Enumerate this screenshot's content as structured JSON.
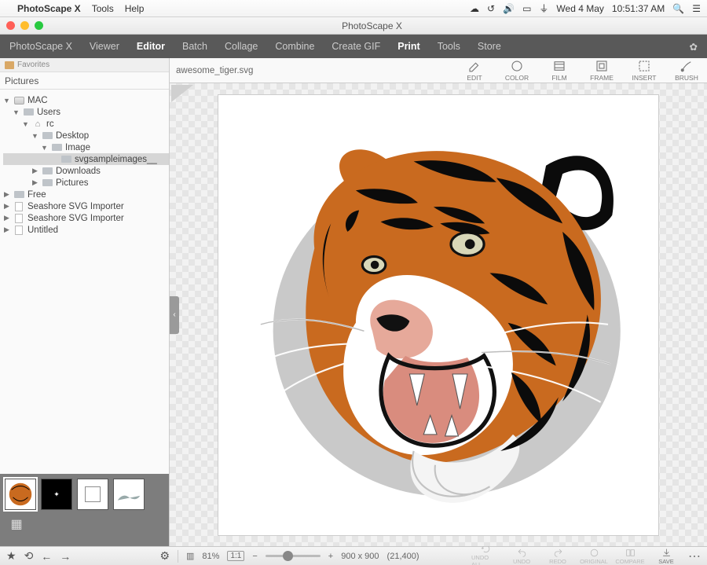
{
  "menubar": {
    "app_name": "PhotoScape X",
    "items": [
      "Tools",
      "Help"
    ],
    "date": "Wed 4 May",
    "time": "10:51:37 AM"
  },
  "titlebar": {
    "title": "PhotoScape X"
  },
  "toolbar": {
    "tabs": [
      "PhotoScape X",
      "Viewer",
      "Editor",
      "Batch",
      "Collage",
      "Combine",
      "Create GIF",
      "Print",
      "Tools",
      "Store"
    ],
    "active_index": 2
  },
  "sidebar": {
    "favorites_label": "Favorites",
    "pictures_label": "Pictures",
    "tree": {
      "root": "MAC",
      "users": "Users",
      "rc": "rc",
      "desktop": "Desktop",
      "image": "Image",
      "svgfolder": "svgsampleimages__",
      "downloads": "Downloads",
      "picfolder": "Pictures",
      "free": "Free",
      "seashore1": "Seashore SVG Importer",
      "seashore2": "Seashore SVG Importer",
      "untitled": "Untitled"
    }
  },
  "editor": {
    "filename": "awesome_tiger.svg",
    "tools": [
      "EDIT",
      "COLOR",
      "FILM",
      "FRAME",
      "INSERT",
      "BRUSH"
    ]
  },
  "bottombar": {
    "zoom": "81%",
    "ratio": "1:1",
    "dimensions": "900 x 900",
    "coords": "(21,400)",
    "actions": [
      "UNDO ALL",
      "UNDO",
      "REDO",
      "ORIGINAL",
      "COMPARE",
      "SAVE"
    ]
  }
}
